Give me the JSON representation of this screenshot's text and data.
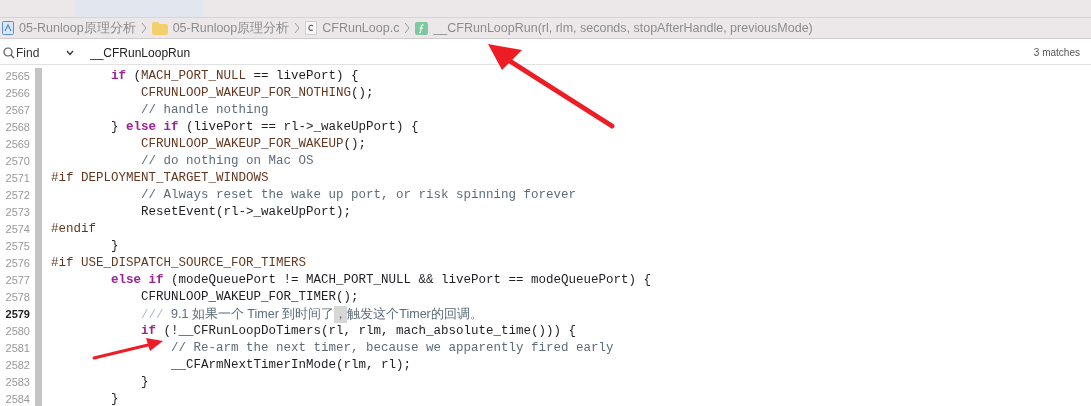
{
  "breadcrumbs": [
    {
      "kind": "project",
      "label": "05-Runloop原理分析"
    },
    {
      "kind": "folder",
      "label": "05-Runloop原理分析"
    },
    {
      "kind": "c-file",
      "label": "CFRunLoop.c"
    },
    {
      "kind": "function",
      "label": "__CFRunLoopRun(rl, rlm, seconds, stopAfterHandle, previousMode)"
    }
  ],
  "find_bar": {
    "mode": "Find",
    "value": "__CFRunLoopRun",
    "matches": "3 matches"
  },
  "code": [
    {
      "number": "2565",
      "current": false,
      "kind": "outer",
      "segments": [
        {
          "t": "if",
          "kind": "keyword"
        },
        {
          "t": " (",
          "kind": "plain"
        },
        {
          "t": "MACH_PORT_NULL",
          "kind": "macro"
        },
        {
          "t": " == livePort) {",
          "kind": "plain"
        }
      ]
    },
    {
      "number": "2566",
      "current": false,
      "kind": "inner",
      "segments": [
        {
          "t": "CFRUNLOOP_WAKEUP_FOR_NOTHING",
          "kind": "macro"
        },
        {
          "t": "();",
          "kind": "plain"
        }
      ]
    },
    {
      "number": "2567",
      "current": false,
      "kind": "inner",
      "segments": [
        {
          "t": "// handle nothing",
          "kind": "comment"
        }
      ]
    },
    {
      "number": "2568",
      "current": false,
      "kind": "outer",
      "segments": [
        {
          "t": "} ",
          "kind": "plain"
        },
        {
          "t": "else if",
          "kind": "keyword"
        },
        {
          "t": " (livePort == rl->_wakeUpPort) {",
          "kind": "plain"
        }
      ]
    },
    {
      "number": "2569",
      "current": false,
      "kind": "inner",
      "segments": [
        {
          "t": "CFRUNLOOP_WAKEUP_FOR_WAKEUP",
          "kind": "macro"
        },
        {
          "t": "();",
          "kind": "plain"
        }
      ]
    },
    {
      "number": "2570",
      "current": false,
      "kind": "inner",
      "segments": [
        {
          "t": "// do nothing on Mac OS",
          "kind": "comment"
        }
      ]
    },
    {
      "number": "2571",
      "current": false,
      "kind": "directive",
      "segments": [
        {
          "t": "#if DEPLOYMENT_TARGET_WINDOWS",
          "kind": "macro"
        }
      ]
    },
    {
      "number": "2572",
      "current": false,
      "kind": "inner",
      "segments": [
        {
          "t": "// Always reset the wake up port, or risk spinning forever",
          "kind": "comment"
        }
      ]
    },
    {
      "number": "2573",
      "current": false,
      "kind": "inner",
      "segments": [
        {
          "t": "ResetEvent(rl->_wakeUpPort);",
          "kind": "plain"
        }
      ]
    },
    {
      "number": "2574",
      "current": false,
      "kind": "directive",
      "segments": [
        {
          "t": "#endif",
          "kind": "macro"
        }
      ]
    },
    {
      "number": "2575",
      "current": false,
      "kind": "outer",
      "segments": [
        {
          "t": "}",
          "kind": "plain"
        }
      ]
    },
    {
      "number": "2576",
      "current": false,
      "kind": "directive",
      "segments": [
        {
          "t": "#if USE_DISPATCH_SOURCE_FOR_TIMERS",
          "kind": "macro"
        }
      ]
    },
    {
      "number": "2577",
      "current": false,
      "kind": "outer",
      "segments": [
        {
          "t": "else if",
          "kind": "keyword"
        },
        {
          "t": " (modeQueuePort != MACH_PORT_NULL && livePort == modeQueuePort) {",
          "kind": "plain"
        }
      ]
    },
    {
      "number": "2578",
      "current": false,
      "kind": "inner",
      "segments": [
        {
          "t": "CFRUNLOOP_WAKEUP_FOR_TIMER();",
          "kind": "plain"
        }
      ]
    },
    {
      "number": "2579",
      "current": true,
      "kind": "inner",
      "segments": [
        {
          "t": "/// ",
          "kind": "doc-marker"
        },
        {
          "t": "9.1 如果一个 Timer 到时间了",
          "kind": "doc"
        },
        {
          "t": "，",
          "kind": "highlight"
        },
        {
          "t": "触发这个Timer的回调。",
          "kind": "doc"
        }
      ]
    },
    {
      "number": "2580",
      "current": false,
      "kind": "inner",
      "segments": [
        {
          "t": "if",
          "kind": "keyword"
        },
        {
          "t": " (!__CFRunLoopDoTimers(rl, rlm, mach_absolute_time())) {",
          "kind": "plain"
        }
      ]
    },
    {
      "number": "2581",
      "current": false,
      "kind": "innermost",
      "segments": [
        {
          "t": "// Re-arm the next timer, because we apparently fired early",
          "kind": "comment"
        }
      ]
    },
    {
      "number": "2582",
      "current": false,
      "kind": "innermost",
      "segments": [
        {
          "t": "__CFArmNextTimerInMode(rlm, rl);",
          "kind": "plain"
        }
      ]
    },
    {
      "number": "2583",
      "current": false,
      "kind": "inner",
      "segments": [
        {
          "t": "}",
          "kind": "plain"
        }
      ]
    },
    {
      "number": "2584",
      "current": false,
      "kind": "outer",
      "segments": [
        {
          "t": "}",
          "kind": "plain"
        }
      ]
    }
  ]
}
